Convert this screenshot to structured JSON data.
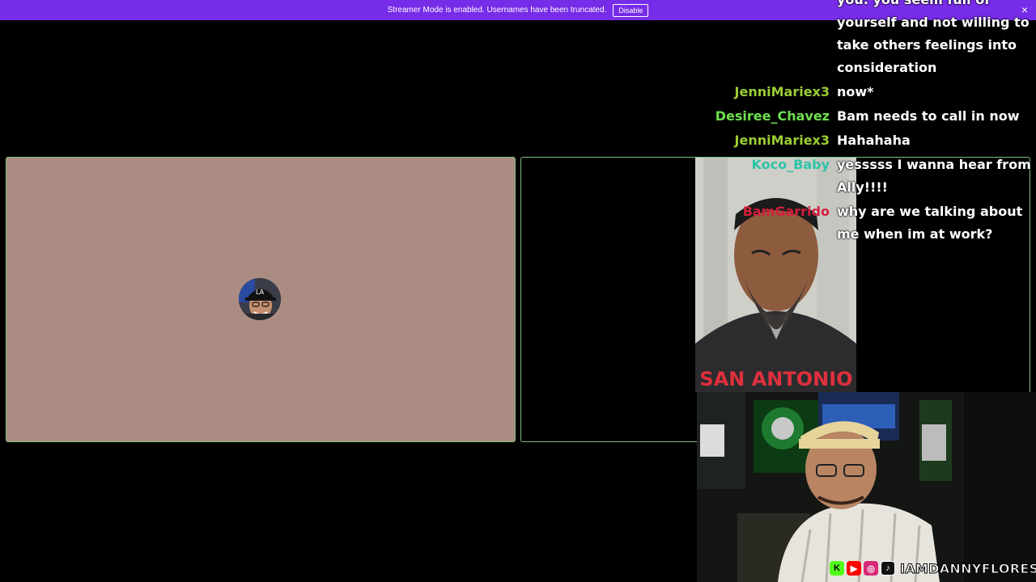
{
  "banner": {
    "text": "Streamer Mode is enabled. Usernames have been truncated.",
    "disable_label": "Disable",
    "close_glyph": "×",
    "color": "#772ce8"
  },
  "chat": {
    "messages": [
      {
        "user": "",
        "text": "you. you seem full of yourself and not willing to take others feelings into consideration",
        "color": "#ffffff"
      },
      {
        "user": "JenniMariex3",
        "text": "now*",
        "color": "#9acd32"
      },
      {
        "user": "Desiree_Chavez",
        "text": "Bam needs to call in now",
        "color": "#6ee04e"
      },
      {
        "user": "JenniMariex3",
        "text": "Hahahaha",
        "color": "#9acd32"
      },
      {
        "user": "Koco_Baby",
        "text": "yesssss I wanna hear from Ally!!!!",
        "color": "#2ec4a8"
      },
      {
        "user": "BamGarrido",
        "text": "why are we talking about me when im at work?",
        "color": "#d21f3c"
      }
    ]
  },
  "overlay": {
    "handle": "IAMDANNYFLORES",
    "socials": [
      {
        "name": "kick-icon",
        "glyph": "K",
        "color": "#53fc18"
      },
      {
        "name": "youtube-icon",
        "glyph": "▶",
        "color": "#ff0000"
      },
      {
        "name": "instagram-icon",
        "glyph": "◎",
        "color": "#d62976"
      },
      {
        "name": "tiktok-icon",
        "glyph": "♪",
        "color": "#111111"
      }
    ]
  },
  "guest_shirt_text": "SAN ANTONIO"
}
